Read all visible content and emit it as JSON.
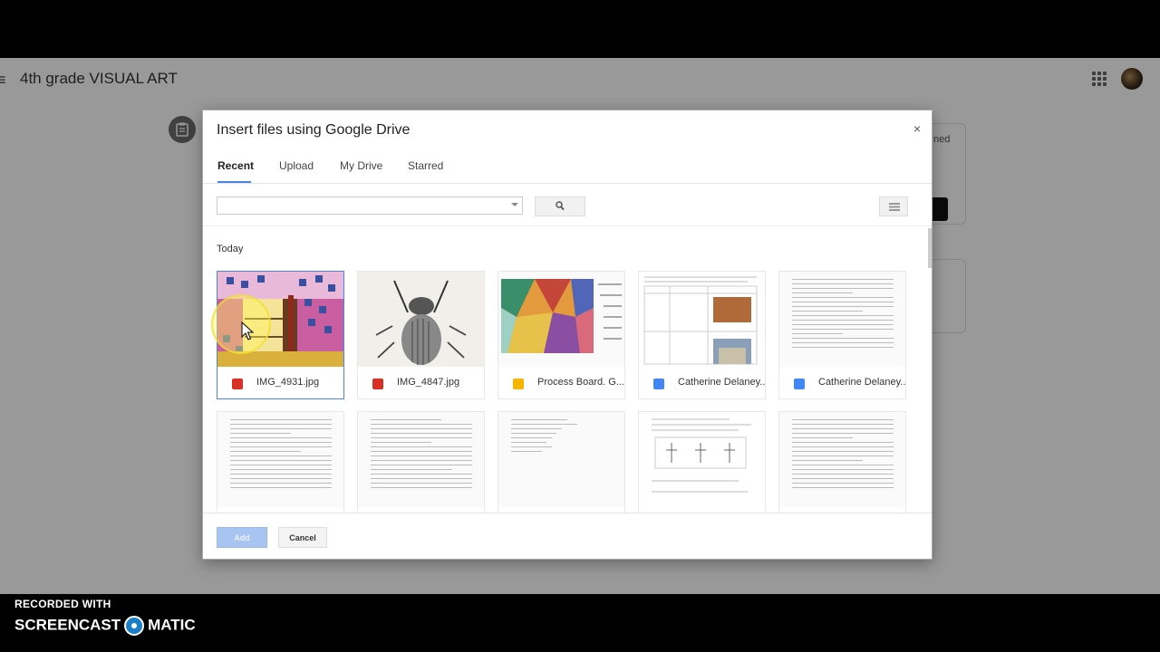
{
  "app": {
    "title": "4th grade VISUAL ART",
    "menu_icon": "hamburger-menu-icon",
    "apps_icon": "apps-grid-icon",
    "avatar_icon": "user-avatar",
    "background_card_text": "ned"
  },
  "dialog": {
    "title": "Insert files using Google Drive",
    "close_label": "×",
    "tabs": [
      {
        "label": "Recent",
        "active": true
      },
      {
        "label": "Upload",
        "active": false
      },
      {
        "label": "My Drive",
        "active": false
      },
      {
        "label": "Starred",
        "active": false
      }
    ],
    "search": {
      "placeholder": "",
      "value": ""
    },
    "section_label": "Today",
    "files": [
      {
        "name": "IMG_4931.jpg",
        "type": "image",
        "icon_color": "#d93025",
        "selected": true
      },
      {
        "name": "IMG_4847.jpg",
        "type": "image",
        "icon_color": "#d93025",
        "selected": false
      },
      {
        "name": "Process Board. G...",
        "type": "slides",
        "icon_color": "#f4b400",
        "selected": false
      },
      {
        "name": "Catherine Delaney...",
        "type": "doc",
        "icon_color": "#4285f4",
        "selected": false
      },
      {
        "name": "Catherine Delaney...",
        "type": "doc",
        "icon_color": "#4285f4",
        "selected": false
      }
    ],
    "add_label": "Add",
    "cancel_label": "Cancel"
  },
  "watermark": {
    "line1": "RECORDED WITH",
    "brand_left": "SCREENCAST",
    "brand_right": "MATIC"
  }
}
